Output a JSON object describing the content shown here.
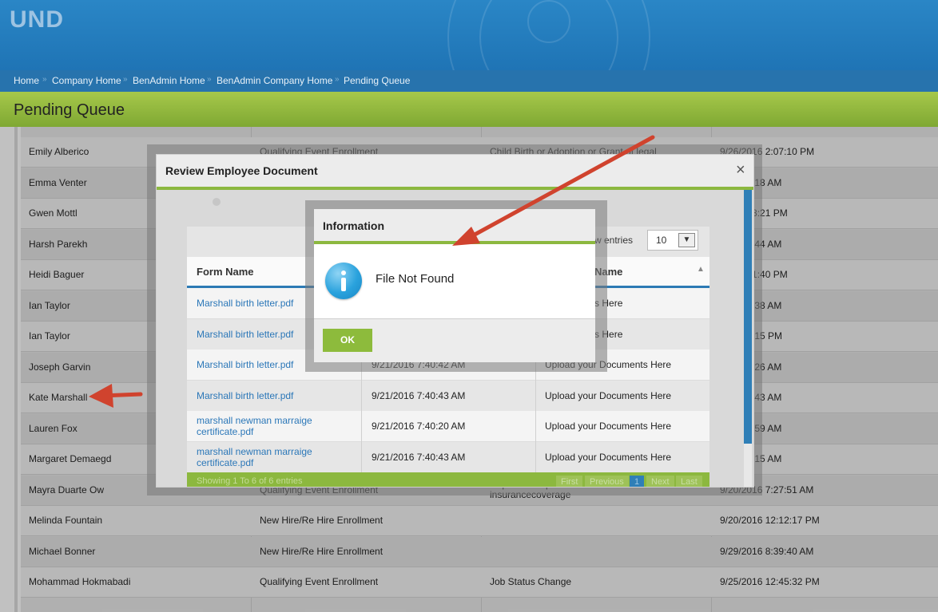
{
  "brand": {
    "text": "UND"
  },
  "breadcrumb": {
    "items": [
      "Home",
      "Company Home",
      "BenAdmin Home",
      "BenAdmin Company Home",
      "Pending Queue"
    ],
    "separator": "»"
  },
  "page": {
    "title": "Pending Queue"
  },
  "background_table": {
    "rows": [
      {
        "name": "Emily Alberico",
        "type": "Qualifying Event Enrollment",
        "reason": "Child Birth or Adoption or Grant of legal",
        "date": "9/26/2016 2:07:10 PM"
      },
      {
        "name": "Emma Venter",
        "type": "",
        "reason": "",
        "date": "16 8:06:18 AM"
      },
      {
        "name": "Gwen Mottl",
        "type": "",
        "reason": "",
        "date": "16 12:38:21 PM"
      },
      {
        "name": "Harsh Parekh",
        "type": "",
        "reason": "",
        "date": "16 6:19:44 AM"
      },
      {
        "name": "Heidi Baguer",
        "type": "",
        "reason": "",
        "date": "16 12:51:40 PM"
      },
      {
        "name": "Ian Taylor",
        "type": "",
        "reason": "",
        "date": "16 7:01:38 AM"
      },
      {
        "name": "Ian Taylor",
        "type": "",
        "reason": "",
        "date": "16 4:24:15 PM"
      },
      {
        "name": "Joseph Garvin",
        "type": "",
        "reason": "",
        "date": "16 7:22:26 AM"
      },
      {
        "name": "Kate Marshall",
        "type": "",
        "reason": "",
        "date": "16 7:40:43 AM"
      },
      {
        "name": "Lauren Fox",
        "type": "",
        "reason": "",
        "date": "16 7:01:59 AM"
      },
      {
        "name": "Margaret Demaegd",
        "type": "",
        "reason": "",
        "date": "16 6:07:15 AM"
      },
      {
        "name": "Mayra Duarte Ow",
        "type": "Qualifying Event Enrollment",
        "reason": "Dependent Spouse or Child loses his or her insurancecoverage",
        "date": "9/20/2016 7:27:51 AM"
      },
      {
        "name": "Melinda Fountain",
        "type": "New Hire/Re Hire Enrollment",
        "reason": "",
        "date": "9/20/2016 12:12:17 PM"
      },
      {
        "name": "Michael Bonner",
        "type": "New Hire/Re Hire Enrollment",
        "reason": "",
        "date": "9/29/2016 8:39:40 AM"
      },
      {
        "name": "Mohammad Hokmabadi",
        "type": "Qualifying Event Enrollment",
        "reason": "Job Status Change",
        "date": "9/25/2016 12:45:32 PM"
      }
    ]
  },
  "review_modal": {
    "title": "Review Employee Document",
    "close_icon": "×",
    "entries_label": "w entries",
    "entries_value": "10",
    "columns": [
      "Form Name",
      "Name"
    ],
    "rows": [
      {
        "file": "Marshall birth letter.pdf",
        "date": "",
        "name": "r Documents Here"
      },
      {
        "file": "Marshall birth letter.pdf",
        "date": "",
        "name": "r Documents Here"
      },
      {
        "file": "Marshall birth letter.pdf",
        "date": "9/21/2016 7:40:42 AM",
        "name": "Upload your Documents Here"
      },
      {
        "file": "Marshall birth letter.pdf",
        "date": "9/21/2016 7:40:43 AM",
        "name": "Upload your Documents Here"
      },
      {
        "file": "marshall newman marraige certificate.pdf",
        "date": "9/21/2016 7:40:20 AM",
        "name": "Upload your Documents Here"
      },
      {
        "file": "marshall newman marraige certificate.pdf",
        "date": "9/21/2016 7:40:43 AM",
        "name": "Upload your Documents Here"
      }
    ],
    "footer": {
      "summary": "Showing 1 To 6 of 6 entries",
      "first": "First",
      "previous": "Previous",
      "page": "1",
      "next": "Next",
      "last": "Last"
    }
  },
  "info_dialog": {
    "title": "Information",
    "message": "File Not Found",
    "ok_label": "OK",
    "icon": "info-icon"
  },
  "colors": {
    "header_blue": "#2a86c6",
    "accent_green": "#8cb83f",
    "link_blue": "#2b77b8",
    "arrow_red": "#d0432e"
  }
}
